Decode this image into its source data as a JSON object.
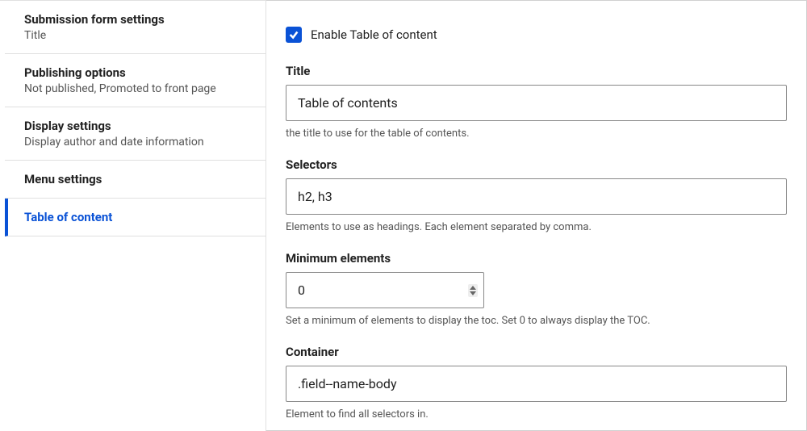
{
  "sidebar": {
    "items": [
      {
        "title": "Submission form settings",
        "sub": "Title"
      },
      {
        "title": "Publishing options",
        "sub": "Not published, Promoted to front page"
      },
      {
        "title": "Display settings",
        "sub": "Display author and date information"
      },
      {
        "title": "Menu settings",
        "sub": ""
      },
      {
        "title": "Table of content",
        "sub": ""
      }
    ]
  },
  "form": {
    "enable_label": "Enable Table of content",
    "title": {
      "label": "Title",
      "value": "Table of contents",
      "help": "the title to use for the table of contents."
    },
    "selectors": {
      "label": "Selectors",
      "value": "h2, h3",
      "help": "Elements to use as headings. Each element separated by comma."
    },
    "min_elements": {
      "label": "Minimum elements",
      "value": "0",
      "help": "Set a minimum of elements to display the toc. Set 0 to always display the TOC."
    },
    "container": {
      "label": "Container",
      "value": ".field--name-body",
      "help": "Element to find all selectors in."
    }
  }
}
